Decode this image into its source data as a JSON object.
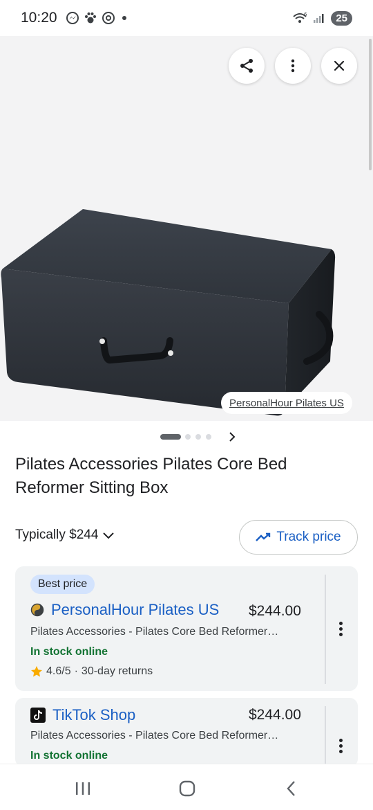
{
  "status_bar": {
    "time": "10:20",
    "battery": "25",
    "signal_label": "6",
    "icons": [
      "messenger-icon",
      "paw-icon",
      "threads-icon",
      "dot-icon",
      "wifi-icon",
      "signal-icon",
      "battery-icon"
    ]
  },
  "image": {
    "source_label": "PersonalHour Pilates US",
    "actions": [
      "share-icon",
      "more-vert-icon",
      "close-icon"
    ]
  },
  "carousel": {
    "pages": 4,
    "current": 1
  },
  "product": {
    "title": "Pilates Accessories Pilates Core Bed Reformer Sitting Box",
    "typically_label": "Typically $244",
    "track_price_label": "Track price"
  },
  "offers": [
    {
      "badge": "Best price",
      "seller": "PersonalHour Pilates US",
      "price": "$244.00",
      "description": "Pilates Accessories - Pilates Core Bed Reformer…",
      "stock": "In stock online",
      "rating": "4.6/5",
      "separator": "·",
      "returns": "30-day returns"
    },
    {
      "seller": "TikTok Shop",
      "price": "$244.00",
      "description": "Pilates Accessories - Pilates Core Bed Reformer…",
      "stock": "In stock online"
    }
  ],
  "colors": {
    "link_blue": "#1a5fc4",
    "stock_green": "#137333",
    "badge_bg": "#d3e3fd",
    "card_bg": "#f1f3f4",
    "star": "#f9ab00"
  },
  "nav_bar": [
    "recents-icon",
    "home-icon",
    "back-icon"
  ]
}
